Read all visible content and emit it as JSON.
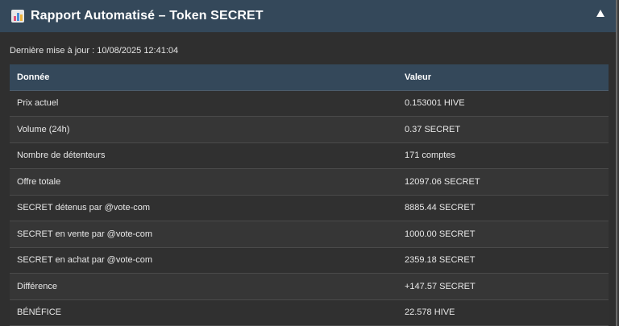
{
  "header": {
    "title": "Rapport Automatisé – Token SECRET",
    "icon": "bar-chart-report-icon"
  },
  "updated": "Dernière mise à jour : 10/08/2025 12:41:04",
  "table": {
    "columns": [
      "Donnée",
      "Valeur"
    ],
    "rows": [
      [
        "Prix actuel",
        "0.153001 HIVE"
      ],
      [
        "Volume (24h)",
        "0.37 SECRET"
      ],
      [
        "Nombre de détenteurs",
        "171 comptes"
      ],
      [
        "Offre totale",
        "12097.06 SECRET"
      ],
      [
        "SECRET détenus par @vote-com",
        "8885.44 SECRET"
      ],
      [
        "SECRET en vente par @vote-com",
        "1000.00 SECRET"
      ],
      [
        "SECRET en achat par @vote-com",
        "2359.18 SECRET"
      ],
      [
        "Différence",
        "+147.57 SECRET"
      ],
      [
        "BÉNÉFICE",
        "22.578 HIVE"
      ]
    ]
  },
  "colors": {
    "header_bg": "#34485a",
    "panel_bg": "#2f2f2f"
  }
}
